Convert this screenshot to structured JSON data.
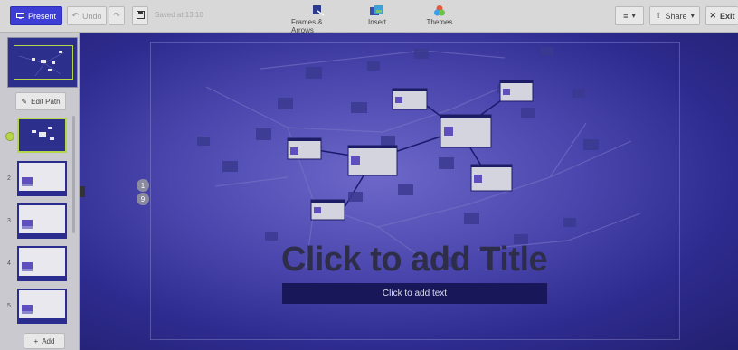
{
  "toolbar": {
    "present_label": "Present",
    "undo_label": "Undo",
    "saved_text": "Saved at 13:10",
    "frames_label": "Frames & Arrows",
    "insert_label": "Insert",
    "themes_label": "Themes",
    "share_label": "Share",
    "exit_label": "Exit"
  },
  "sidebar": {
    "edit_path_label": "Edit Path",
    "add_label": "Add",
    "slides": [
      {
        "number": ""
      },
      {
        "number": "2"
      },
      {
        "number": "3"
      },
      {
        "number": "4"
      },
      {
        "number": "5"
      }
    ]
  },
  "canvas": {
    "badge_1": "1",
    "badge_2": "9",
    "title": "Click to add Title",
    "subtitle": "Click to add text"
  },
  "colors": {
    "accent": "#3c3ed6",
    "selection": "#b6d64a",
    "canvas_bg": "#4a46ad",
    "frame": "#17175a"
  }
}
